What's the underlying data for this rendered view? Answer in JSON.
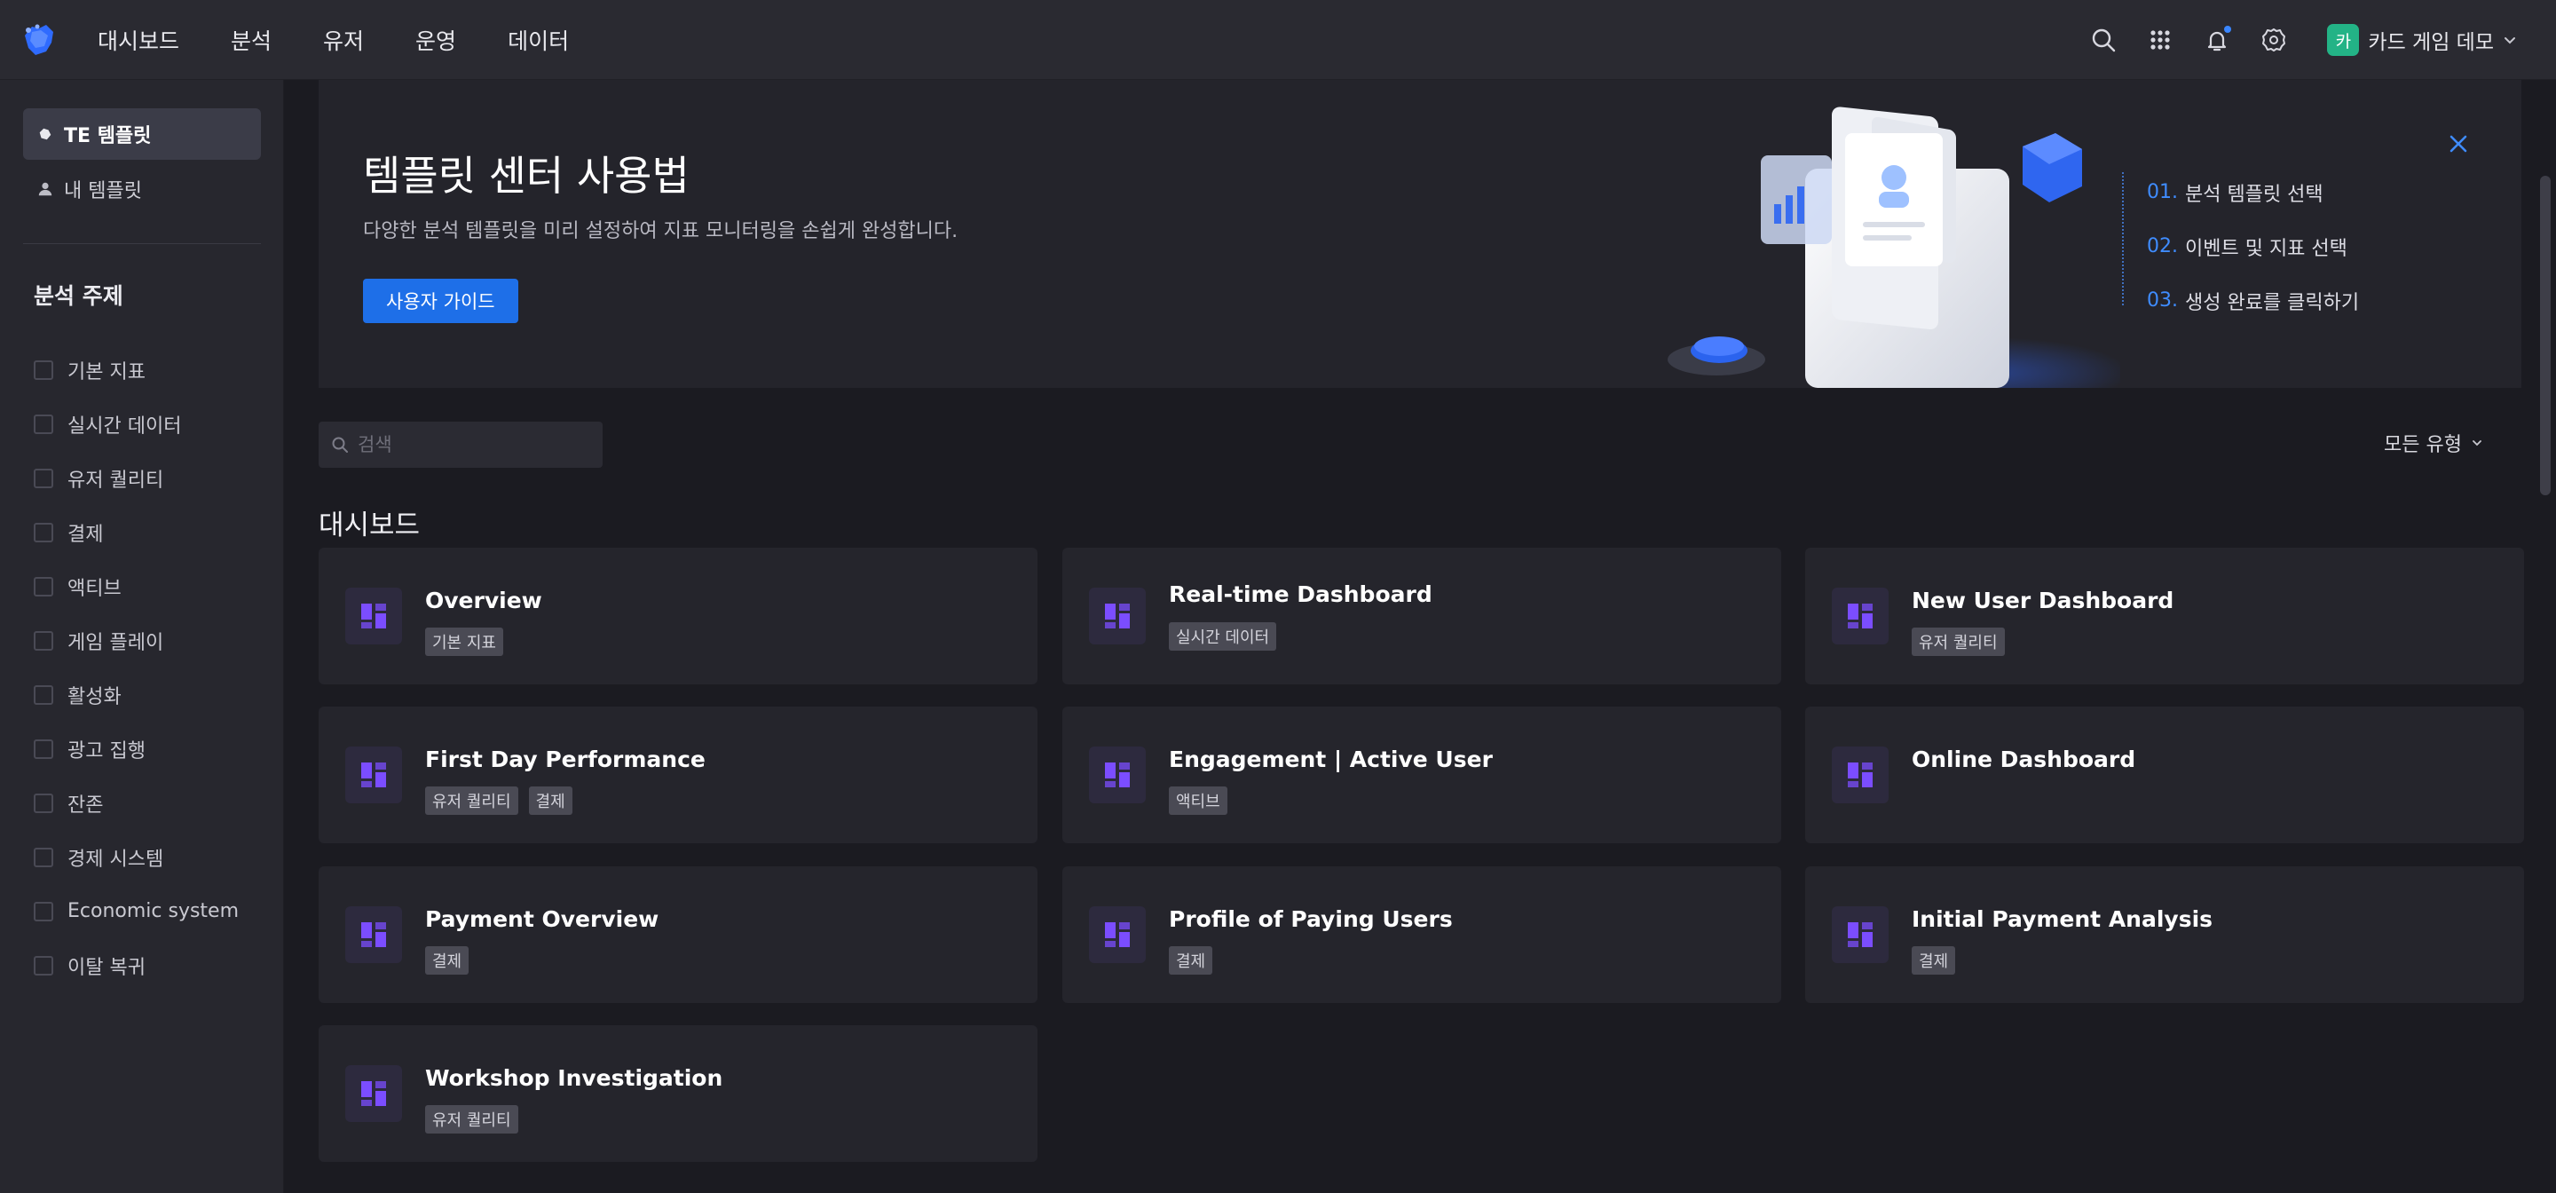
{
  "nav": {
    "menu": [
      "대시보드",
      "분석",
      "유저",
      "운영",
      "데이터"
    ],
    "profile": {
      "avatar_text": "카",
      "name": "카드 게임 데모"
    },
    "icons": [
      "search-icon",
      "apps-grid-icon",
      "bell-icon",
      "gear-icon",
      "chevron-down-icon"
    ]
  },
  "sidebar": {
    "tabs": [
      {
        "label": "TE 템플릿",
        "icon": "template-icon",
        "active": true
      },
      {
        "label": "내 템플릿",
        "icon": "user-icon",
        "active": false
      }
    ],
    "heading": "분석 주제",
    "categories": [
      "기본 지표",
      "실시간 데이터",
      "유저 퀄리티",
      "결제",
      "액티브",
      "게임 플레이",
      "활성화",
      "광고 집행",
      "잔존",
      "경제 시스템",
      "Economic system",
      "이탈 복귀"
    ]
  },
  "banner": {
    "title": "템플릿 센터 사용법",
    "description": "다양한 분석 템플릿을 미리 설정하여 지표 모니터링을 손쉽게 완성합니다.",
    "button_label": "사용자 가이드",
    "steps": [
      {
        "num": "01.",
        "text": "분석 템플릿 선택"
      },
      {
        "num": "02.",
        "text": "이벤트 및 지표 선택"
      },
      {
        "num": "03.",
        "text": "생성 완료를 클릭하기"
      }
    ]
  },
  "search": {
    "placeholder": "검색",
    "value": ""
  },
  "filter": {
    "label": "모든 유형"
  },
  "section": {
    "title": "대시보드"
  },
  "cards": [
    {
      "title": "Overview",
      "tags": [
        "기본 지표"
      ]
    },
    {
      "title": "Real-time Dashboard",
      "tags": [
        "실시간 데이터"
      ]
    },
    {
      "title": "New User Dashboard",
      "tags": [
        "유저 퀄리티"
      ]
    },
    {
      "title": "First Day Performance",
      "tags": [
        "유저 퀄리티",
        "결제"
      ]
    },
    {
      "title": "Engagement | Active User",
      "tags": [
        "액티브"
      ]
    },
    {
      "title": "Online Dashboard",
      "tags": []
    },
    {
      "title": "Payment Overview",
      "tags": [
        "결제"
      ]
    },
    {
      "title": "Profile of Paying Users",
      "tags": [
        "결제"
      ]
    },
    {
      "title": "Initial Payment Analysis",
      "tags": [
        "결제"
      ]
    },
    {
      "title": "Workshop Investigation",
      "tags": [
        "유저 퀄리티"
      ]
    }
  ],
  "colors": {
    "accent": "#1e6fe8",
    "card_icon": "#7b4dff",
    "avatar": "#23b386"
  }
}
